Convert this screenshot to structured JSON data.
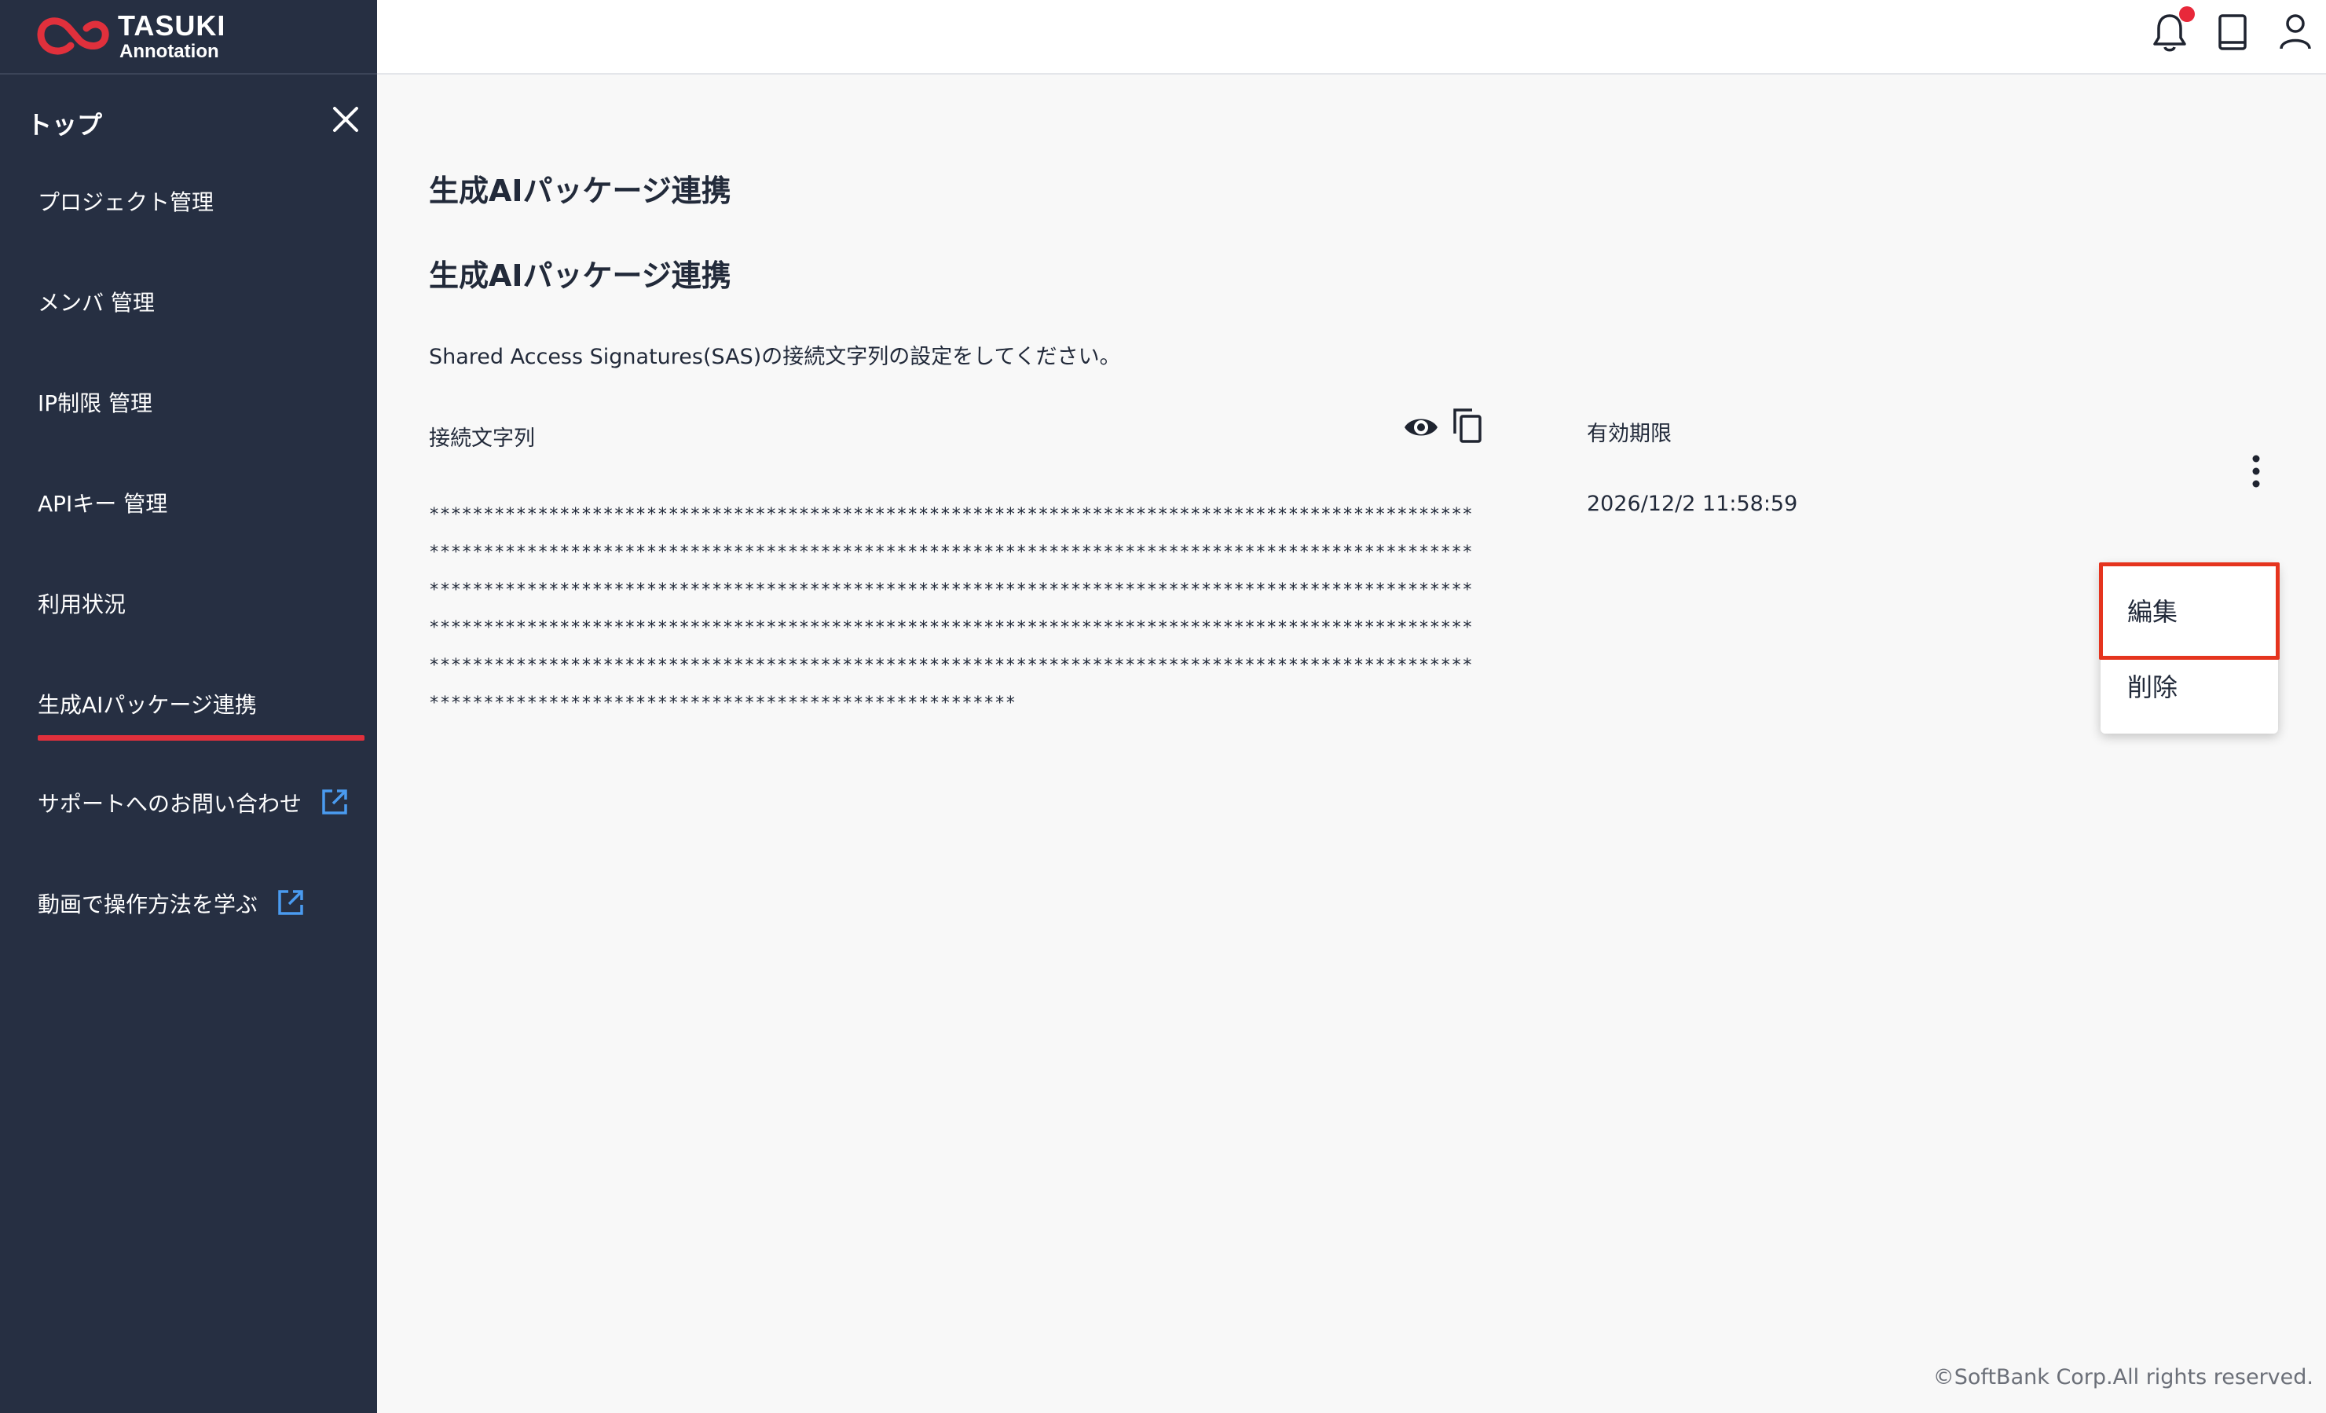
{
  "brand": {
    "line1": "TASUKI",
    "line2": "Annotation",
    "accent": "#e0303c"
  },
  "sidebar": {
    "top_label": "トップ",
    "close_icon": "close-icon",
    "items": [
      {
        "label": "プロジェクト管理"
      },
      {
        "label": "メンバ 管理"
      },
      {
        "label": "IP制限 管理"
      },
      {
        "label": "APIキー 管理"
      },
      {
        "label": "利用状況"
      },
      {
        "label": "生成AIパッケージ連携",
        "active": true
      },
      {
        "label": "サポートへのお問い合わせ",
        "icon": "external-link-icon"
      },
      {
        "label": "動画で操作方法を学ぶ",
        "icon": "external-link-icon"
      }
    ]
  },
  "header": {
    "icons": [
      "bell-icon",
      "book-icon",
      "user-icon"
    ],
    "has_notification": true
  },
  "main": {
    "page_title": "生成AIパッケージ連携",
    "section_title": "生成AIパッケージ連携",
    "description": "Shared Access Signatures(SAS)の接続文字列の設定をしてください。",
    "columns": {
      "connection": "接続文字列",
      "expiry": "有効期限"
    },
    "connection_masked": "******************************************************************************************************************************************************************************************************************************************************************************************************************************************************************************************************************************************************************************************************************************************************",
    "expiry_value": "2026/12/2 11:58:59"
  },
  "menu": {
    "edit": "編集",
    "delete": "削除"
  },
  "footer": {
    "copyright": "©SoftBank Corp.All rights reserved."
  }
}
